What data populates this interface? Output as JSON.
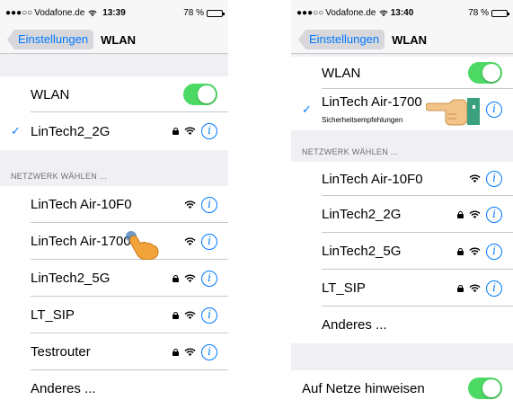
{
  "left": {
    "status": {
      "carrier": "Vodafone.de",
      "time": "13:39",
      "battery": "78 %"
    },
    "nav": {
      "back": "Einstellungen",
      "title": "WLAN"
    },
    "wlan_label": "WLAN",
    "connected": {
      "name": "LinTech2_2G",
      "locked": true
    },
    "section_header": "NETZWERK WÄHLEN ...",
    "networks": [
      {
        "name": "LinTech Air-10F0",
        "locked": false
      },
      {
        "name": "LinTech Air-1700",
        "locked": false
      },
      {
        "name": "LinTech2_5G",
        "locked": true
      },
      {
        "name": "LT_SIP",
        "locked": true
      },
      {
        "name": "Testrouter",
        "locked": true
      }
    ],
    "other": "Anderes ..."
  },
  "right": {
    "status": {
      "carrier": "Vodafone.de",
      "time": "13:40",
      "battery": "78 %"
    },
    "nav": {
      "back": "Einstellungen",
      "title": "WLAN"
    },
    "wlan_label": "WLAN",
    "connected": {
      "name": "LinTech Air-1700",
      "subtitle": "Sicherheitsempfehlungen",
      "locked": false
    },
    "section_header": "NETZWERK WÄHLEN ...",
    "networks": [
      {
        "name": "LinTech Air-10F0",
        "locked": false
      },
      {
        "name": "LinTech2_2G",
        "locked": true
      },
      {
        "name": "LinTech2_5G",
        "locked": true
      },
      {
        "name": "LT_SIP",
        "locked": true
      }
    ],
    "other": "Anderes ...",
    "ask_to_join": "Auf Netze hinweisen"
  },
  "colors": {
    "accent": "#007aff",
    "toggle_on": "#4cd964"
  },
  "wlan_enabled": true,
  "ask_to_join_enabled": true
}
